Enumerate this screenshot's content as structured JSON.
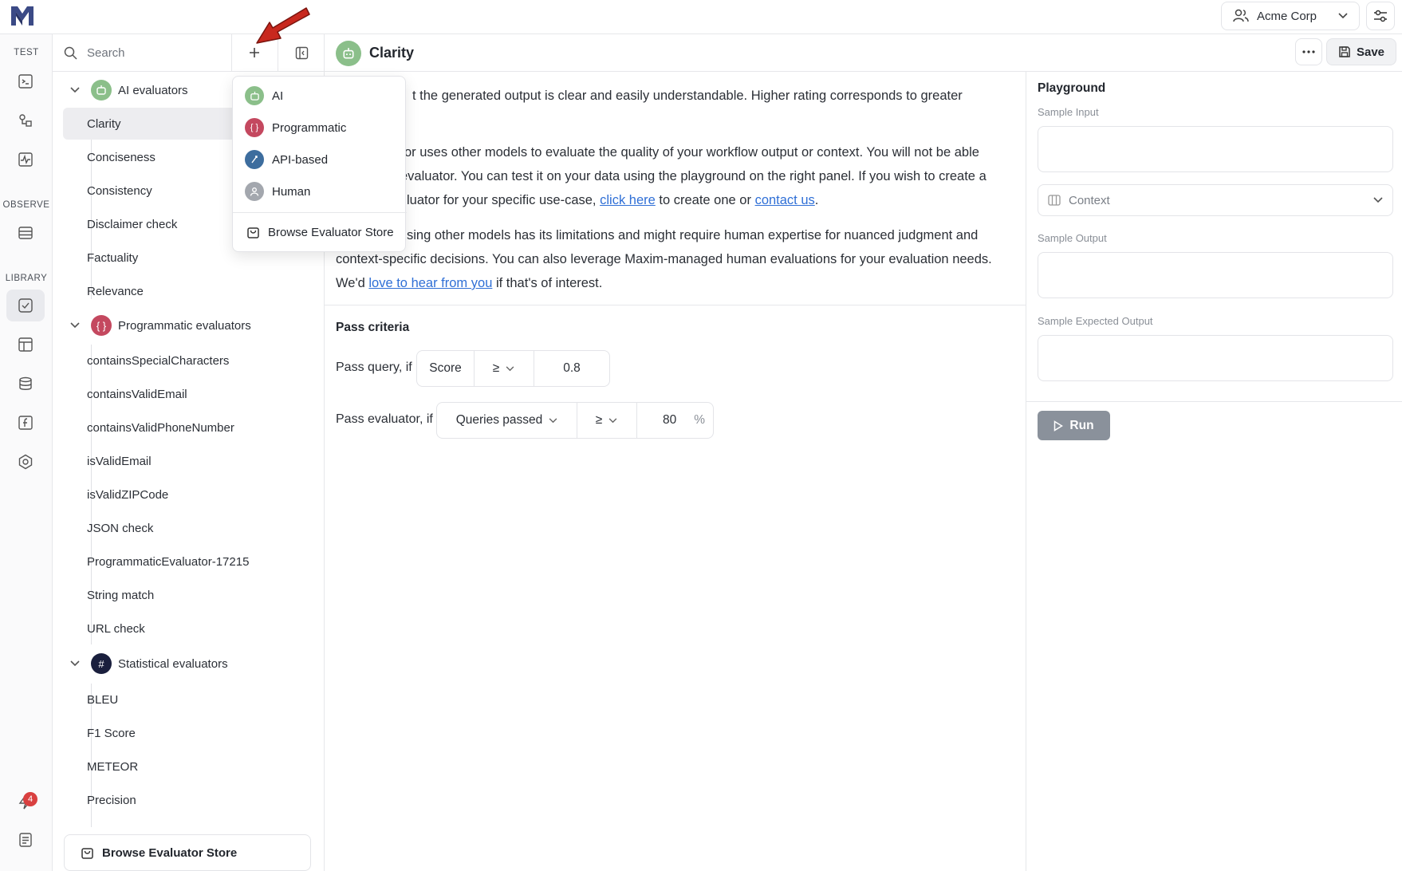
{
  "topbar": {
    "org_name": "Acme Corp"
  },
  "rail": {
    "sections": [
      "TEST",
      "OBSERVE",
      "LIBRARY"
    ],
    "badge_count": "4"
  },
  "sidebar": {
    "search_placeholder": "Search",
    "groups": [
      {
        "label": "AI evaluators",
        "icon": "robot-icon",
        "color": "#8bbf8a",
        "items": [
          "Clarity",
          "Conciseness",
          "Consistency",
          "Disclaimer check",
          "Factuality",
          "Relevance"
        ]
      },
      {
        "label": "Programmatic evaluators",
        "icon": "code-braces-icon",
        "color": "#c4485f",
        "items": [
          "containsSpecialCharacters",
          "containsValidEmail",
          "containsValidPhoneNumber",
          "isValidEmail",
          "isValidZIPCode",
          "JSON check",
          "ProgrammaticEvaluator-17215",
          "String match",
          "URL check"
        ]
      },
      {
        "label": "Statistical evaluators",
        "icon": "hash-icon",
        "color": "#1a1f3d",
        "items": [
          "BLEU",
          "F1 Score",
          "METEOR",
          "Precision"
        ]
      }
    ],
    "selected_item": "Clarity",
    "browse_label": "Browse Evaluator Store"
  },
  "menu": {
    "items": [
      {
        "label": "AI",
        "icon": "robot-icon",
        "color": "#8bbf8a"
      },
      {
        "label": "Programmatic",
        "icon": "code-braces-icon",
        "color": "#c4485f"
      },
      {
        "label": "API-based",
        "icon": "api-icon",
        "color": "#3d6d9e"
      },
      {
        "label": "Human",
        "icon": "person-icon",
        "color": "#a3a7ae"
      }
    ],
    "browse_label": "Browse Evaluator Store"
  },
  "main": {
    "title": "Clarity",
    "save_label": "Save",
    "para1": "t the generated output is clear and easily understandable. Higher rating corresponds to greater",
    "para2_line1": "or uses other models to evaluate the quality of your workflow output or context. You will not be able",
    "para2_line2": "evaluator. You can test it on your data using the playground on the right panel. If you wish to create a",
    "para2_line3a": "luator for your specific use-case, ",
    "para2_link1": "click here",
    "para2_line3b": " to create one or ",
    "para2_link2": "contact us",
    "para2_line3c": ".",
    "para3_line1": "sing other models has its limitations and might require human expertise for nuanced judgment and",
    "para3_line2": "context-specific decisions. You can also leverage Maxim-managed human evaluations for your evaluation needs.",
    "para3_line3a": "We'd ",
    "para3_link": "love to hear from you",
    "para3_line3b": " if that's of interest.",
    "pass_criteria_title": "Pass criteria",
    "pass_query_label": "Pass query, if",
    "pass_query_metric": "Score",
    "pass_query_operator": "≥",
    "pass_query_value": "0.8",
    "pass_evaluator_label": "Pass evaluator, if",
    "pass_evaluator_metric": "Queries passed",
    "pass_evaluator_operator": "≥",
    "pass_evaluator_value": "80",
    "pass_evaluator_unit": "%"
  },
  "playground": {
    "title": "Playground",
    "sample_input_label": "Sample Input",
    "context_placeholder": "Context",
    "sample_output_label": "Sample Output",
    "sample_expected_output_label": "Sample Expected Output",
    "run_label": "Run"
  }
}
